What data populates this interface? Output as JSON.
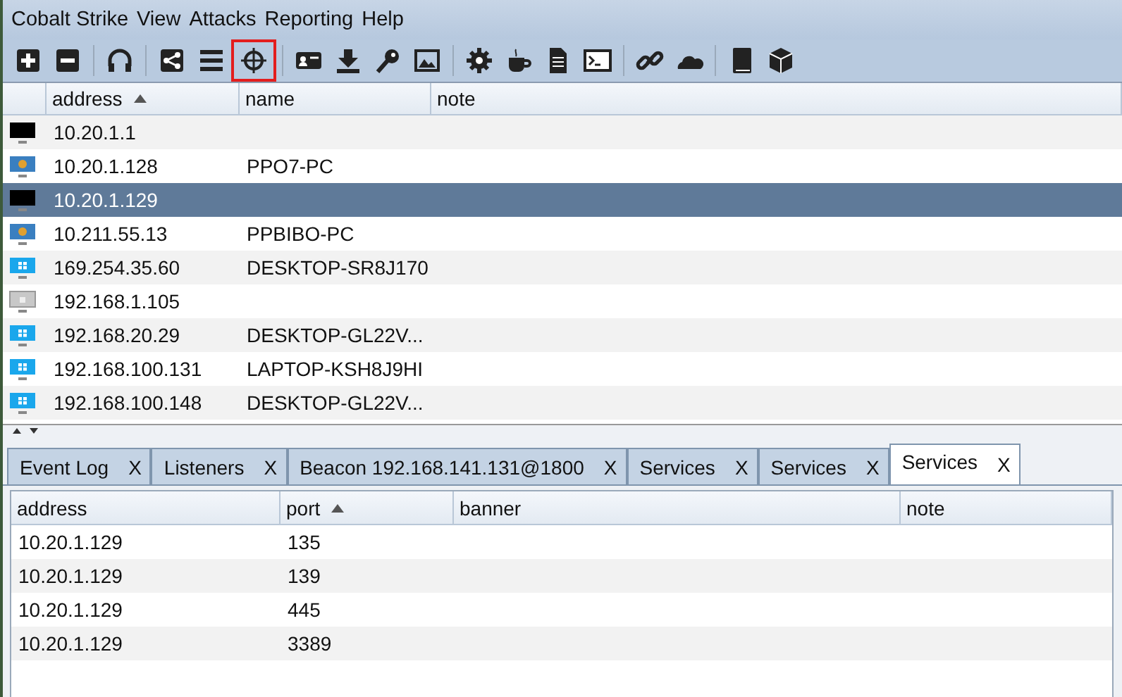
{
  "menu": [
    "Cobalt Strike",
    "View",
    "Attacks",
    "Reporting",
    "Help"
  ],
  "toolbar": [
    {
      "kind": "plus",
      "highlighted": false
    },
    {
      "kind": "minus",
      "highlighted": false
    },
    {
      "kind": "sep"
    },
    {
      "kind": "headphones",
      "highlighted": false
    },
    {
      "kind": "sep"
    },
    {
      "kind": "share",
      "highlighted": false
    },
    {
      "kind": "list",
      "highlighted": false
    },
    {
      "kind": "crosshair",
      "highlighted": true
    },
    {
      "kind": "sep"
    },
    {
      "kind": "card",
      "highlighted": false
    },
    {
      "kind": "download",
      "highlighted": false
    },
    {
      "kind": "key",
      "highlighted": false
    },
    {
      "kind": "image",
      "highlighted": false
    },
    {
      "kind": "sep"
    },
    {
      "kind": "gear",
      "highlighted": false
    },
    {
      "kind": "cup",
      "highlighted": false
    },
    {
      "kind": "document",
      "highlighted": false
    },
    {
      "kind": "terminal",
      "highlighted": false
    },
    {
      "kind": "sep"
    },
    {
      "kind": "link",
      "highlighted": false
    },
    {
      "kind": "cloud",
      "highlighted": false
    },
    {
      "kind": "sep"
    },
    {
      "kind": "book",
      "highlighted": false
    },
    {
      "kind": "cube",
      "highlighted": false
    }
  ],
  "targets": {
    "columns": [
      {
        "label": "address",
        "sorted": true
      },
      {
        "label": "name",
        "sorted": false
      },
      {
        "label": "note",
        "sorted": false
      }
    ],
    "rows": [
      {
        "kind": "dark",
        "address": "10.20.1.1",
        "name": "",
        "selected": false
      },
      {
        "kind": "win7",
        "address": "10.20.1.128",
        "name": "PPO7-PC",
        "selected": false
      },
      {
        "kind": "dark",
        "address": "10.20.1.129",
        "name": "",
        "selected": true
      },
      {
        "kind": "win7",
        "address": "10.211.55.13",
        "name": "PPBIBO-PC",
        "selected": false
      },
      {
        "kind": "win10",
        "address": "169.254.35.60",
        "name": "DESKTOP-SR8J170",
        "selected": false
      },
      {
        "kind": "unknown",
        "address": "192.168.1.105",
        "name": "",
        "selected": false
      },
      {
        "kind": "win10",
        "address": "192.168.20.29",
        "name": "DESKTOP-GL22V...",
        "selected": false
      },
      {
        "kind": "win10",
        "address": "192.168.100.131",
        "name": "LAPTOP-KSH8J9HI",
        "selected": false
      },
      {
        "kind": "win10",
        "address": "192.168.100.148",
        "name": "DESKTOP-GL22V...",
        "selected": false
      }
    ]
  },
  "tabs": [
    {
      "label": "Event Log",
      "close": "X",
      "selected": false
    },
    {
      "label": "Listeners",
      "close": "X",
      "selected": false
    },
    {
      "label": "Beacon 192.168.141.131@1800",
      "close": "X",
      "selected": false
    },
    {
      "label": "Services",
      "close": "X",
      "selected": false
    },
    {
      "label": "Services",
      "close": "X",
      "selected": false
    },
    {
      "label": "Services",
      "close": "X",
      "selected": true
    }
  ],
  "services": {
    "columns": [
      {
        "label": "address",
        "sorted": false
      },
      {
        "label": "port",
        "sorted": true
      },
      {
        "label": "banner",
        "sorted": false
      },
      {
        "label": "note",
        "sorted": false
      }
    ],
    "rows": [
      [
        "10.20.1.129",
        "135",
        "",
        ""
      ],
      [
        "10.20.1.129",
        "139",
        "",
        ""
      ],
      [
        "10.20.1.129",
        "445",
        "",
        ""
      ],
      [
        "10.20.1.129",
        "3389",
        "",
        ""
      ]
    ]
  }
}
